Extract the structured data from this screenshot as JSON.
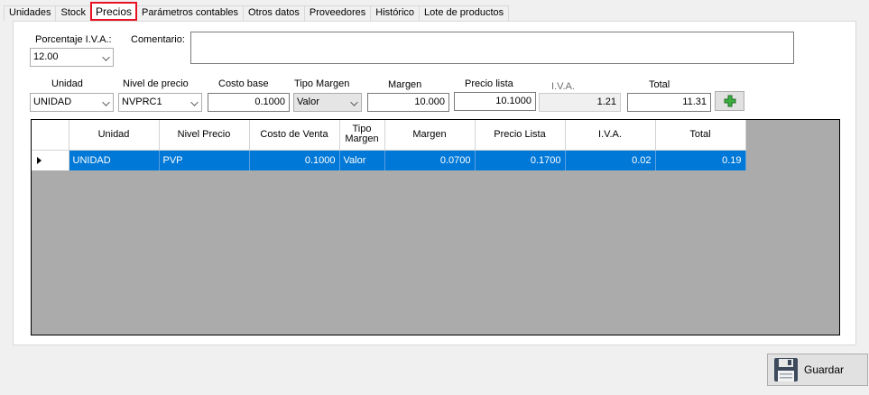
{
  "tabs": [
    {
      "label": "Unidades"
    },
    {
      "label": "Stock"
    },
    {
      "label": "Precios",
      "active": true
    },
    {
      "label": "Parámetros contables"
    },
    {
      "label": "Otros datos"
    },
    {
      "label": "Proveedores"
    },
    {
      "label": "Histórico"
    },
    {
      "label": "Lote de productos"
    }
  ],
  "header": {
    "iva_label": "Porcentaje I.V.A.:",
    "iva_value": "12.00",
    "comment_label": "Comentario:",
    "comment_value": ""
  },
  "price_entry": {
    "unidad_label": "Unidad",
    "unidad_value": "UNIDAD",
    "nivel_label": "Nivel de precio",
    "nivel_value": "NVPRC1",
    "costo_label": "Costo base",
    "costo_value": "0.1000",
    "tipo_label": "Tipo Margen",
    "tipo_value": "Valor",
    "margen_label": "Margen",
    "margen_value": "10.000",
    "precio_label": "Precio lista",
    "precio_value": "10.1000",
    "iva_label": "I.V.A.",
    "iva_value": "1.21",
    "total_label": "Total",
    "total_value": "11.31",
    "add_icon": "plus-icon",
    "add_icon_color": "#2e9e2e"
  },
  "grid": {
    "columns": [
      "Unidad",
      "Nivel Precio",
      "Costo de Venta",
      "Tipo\nMargen",
      "Margen",
      "Precio Lista",
      "I.V.A.",
      "Total"
    ],
    "rows": [
      {
        "unidad": "UNIDAD",
        "nivel": "PVP",
        "costo": "0.1000",
        "tipo": "Valor",
        "margen": "0.0700",
        "precio": "0.1700",
        "iva": "0.02",
        "total": "0.19"
      }
    ],
    "selection_color": "#0078d7"
  },
  "footer": {
    "save_label": "Guardar",
    "save_icon": "floppy-disk-icon"
  }
}
